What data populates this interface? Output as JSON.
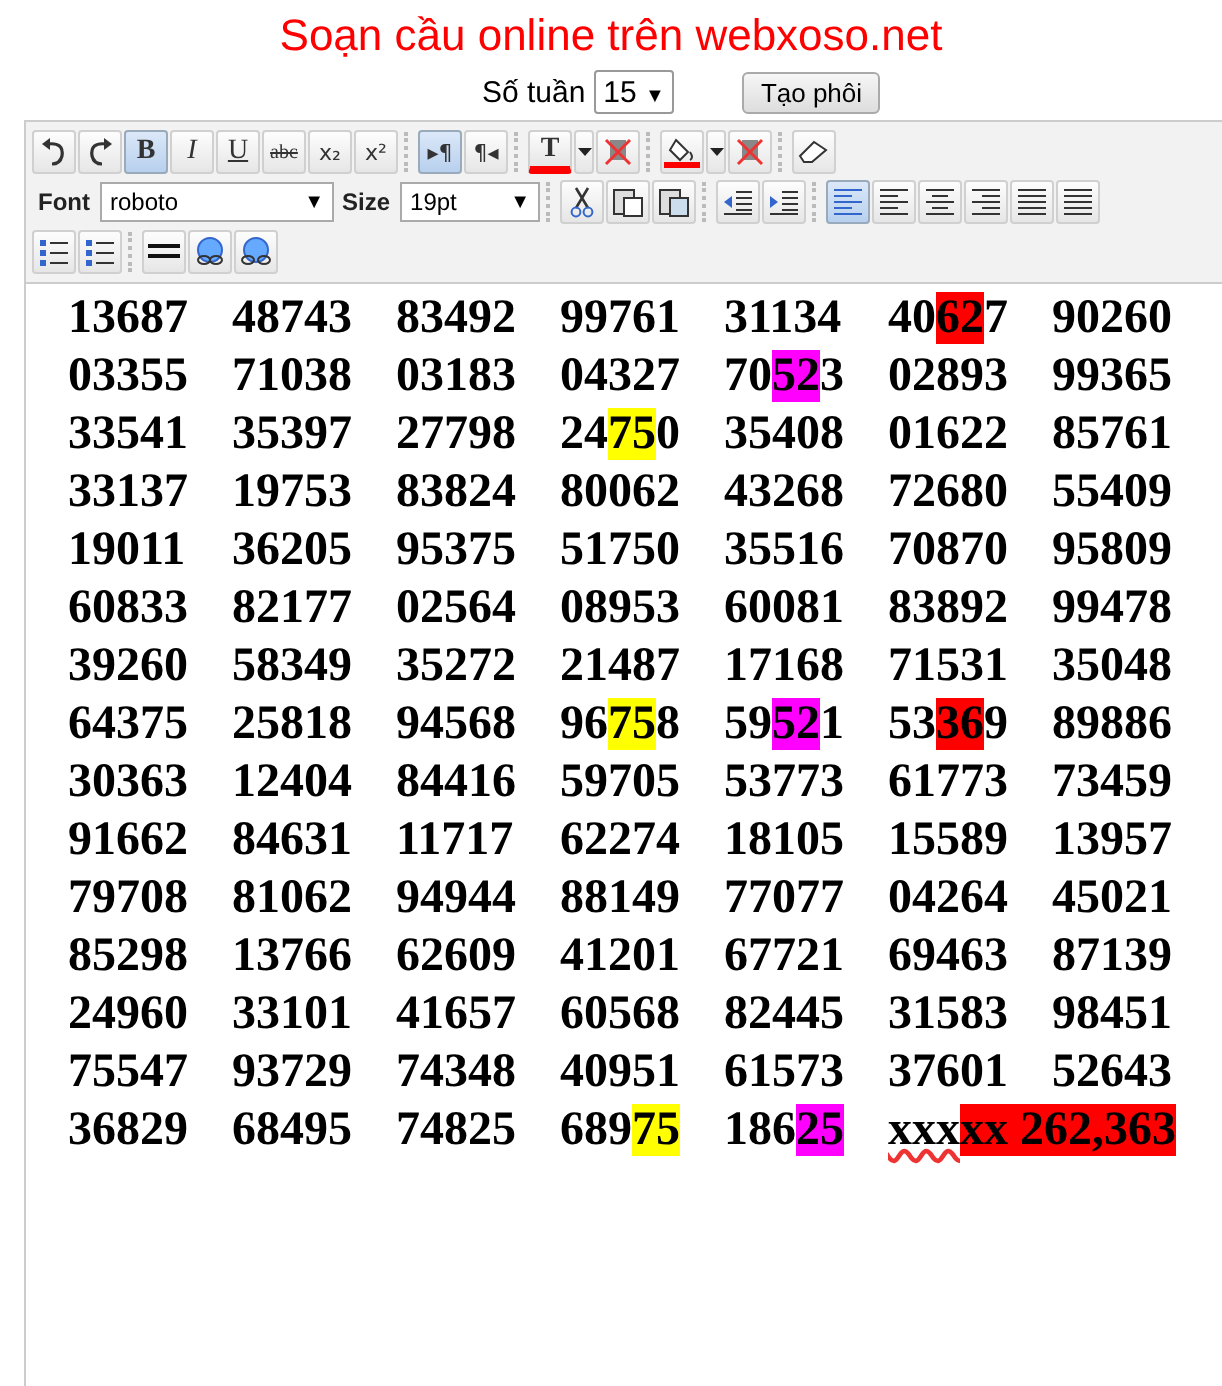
{
  "title": "Soạn cầu online trên webxoso.net",
  "week": {
    "label": "Số tuần",
    "value": "15",
    "arrow": "▼"
  },
  "create_button": "Tạo phôi",
  "toolbar_rows": [
    [
      [
        {
          "kind": "undo",
          "selected": false
        },
        {
          "kind": "redo",
          "selected": false
        },
        {
          "kind": "bold",
          "label": "B",
          "selected": true
        },
        {
          "kind": "italic",
          "label": "I",
          "selected": false
        },
        {
          "kind": "underline",
          "label": "U",
          "selected": false
        },
        {
          "kind": "strike",
          "label": "abc",
          "selected": false
        },
        {
          "kind": "subscript",
          "label": "x₂",
          "selected": false
        },
        {
          "kind": "superscript",
          "label": "x²",
          "selected": false
        }
      ],
      [
        {
          "kind": "ltr",
          "label": "▸¶",
          "selected": true
        },
        {
          "kind": "rtl",
          "label": "¶◂",
          "selected": false
        }
      ],
      [
        {
          "kind": "text-color",
          "label": "T",
          "selected": false
        },
        {
          "kind": "dropdown",
          "selected": false
        },
        {
          "kind": "remove-color",
          "selected": false
        }
      ],
      [
        {
          "kind": "bg-color",
          "selected": false
        },
        {
          "kind": "dropdown",
          "selected": false
        },
        {
          "kind": "remove-bg",
          "selected": false
        }
      ],
      [
        {
          "kind": "eraser",
          "selected": false
        }
      ]
    ],
    [
      [
        {
          "kind": "label",
          "label": "Font"
        },
        {
          "kind": "select",
          "label": "roboto",
          "arrow": "▼"
        },
        {
          "kind": "label",
          "label": "Size"
        },
        {
          "kind": "select-small",
          "label": "19pt",
          "arrow": "▼"
        }
      ],
      [
        {
          "kind": "cut",
          "selected": false
        },
        {
          "kind": "paste",
          "selected": false
        },
        {
          "kind": "paste-word",
          "selected": false
        }
      ],
      [
        {
          "kind": "outdent",
          "selected": false
        },
        {
          "kind": "indent",
          "selected": false
        }
      ],
      [
        {
          "kind": "align-para",
          "selected": true
        },
        {
          "kind": "align-left",
          "selected": false
        },
        {
          "kind": "align-center",
          "selected": false
        },
        {
          "kind": "align-right",
          "selected": false
        },
        {
          "kind": "align-justify",
          "selected": false
        },
        {
          "kind": "align-full",
          "selected": false
        }
      ]
    ],
    [
      [
        {
          "kind": "ordered-list",
          "selected": false
        },
        {
          "kind": "bullet-list",
          "selected": false
        }
      ],
      [
        {
          "kind": "hr",
          "selected": false
        },
        {
          "kind": "link",
          "selected": false
        },
        {
          "kind": "unlink",
          "selected": false
        }
      ]
    ]
  ],
  "rows": [
    [
      [
        {
          "text": "13687"
        }
      ],
      [
        {
          "text": "48743"
        }
      ],
      [
        {
          "text": "83492"
        }
      ],
      [
        {
          "text": "99761"
        }
      ],
      [
        {
          "text": "31134"
        }
      ],
      [
        {
          "text": "40"
        },
        {
          "text": "62",
          "color": "#ff0000"
        },
        {
          "text": "7"
        }
      ],
      [
        {
          "text": "90260"
        }
      ]
    ],
    [
      [
        {
          "text": "03355"
        }
      ],
      [
        {
          "text": "71038"
        }
      ],
      [
        {
          "text": "03183"
        }
      ],
      [
        {
          "text": "04327"
        }
      ],
      [
        {
          "text": "70"
        },
        {
          "text": "52",
          "color": "#ff00ff"
        },
        {
          "text": "3"
        }
      ],
      [
        {
          "text": "02893"
        }
      ],
      [
        {
          "text": "99365"
        }
      ]
    ],
    [
      [
        {
          "text": "33541"
        }
      ],
      [
        {
          "text": "35397"
        }
      ],
      [
        {
          "text": "27798"
        }
      ],
      [
        {
          "text": "24"
        },
        {
          "text": "75",
          "color": "#ffff00"
        },
        {
          "text": "0"
        }
      ],
      [
        {
          "text": "35408"
        }
      ],
      [
        {
          "text": "01622"
        }
      ],
      [
        {
          "text": "85761"
        }
      ]
    ],
    [
      [
        {
          "text": "33137"
        }
      ],
      [
        {
          "text": "19753"
        }
      ],
      [
        {
          "text": "83824"
        }
      ],
      [
        {
          "text": "80062"
        }
      ],
      [
        {
          "text": "43268"
        }
      ],
      [
        {
          "text": "72680"
        }
      ],
      [
        {
          "text": "55409"
        }
      ]
    ],
    [
      [
        {
          "text": "19011"
        }
      ],
      [
        {
          "text": "36205"
        }
      ],
      [
        {
          "text": "95375"
        }
      ],
      [
        {
          "text": "51750"
        }
      ],
      [
        {
          "text": "35516"
        }
      ],
      [
        {
          "text": "70870"
        }
      ],
      [
        {
          "text": "95809"
        }
      ]
    ],
    [
      [
        {
          "text": "60833"
        }
      ],
      [
        {
          "text": "82177"
        }
      ],
      [
        {
          "text": "02564"
        }
      ],
      [
        {
          "text": "08953"
        }
      ],
      [
        {
          "text": "60081"
        }
      ],
      [
        {
          "text": "83892"
        }
      ],
      [
        {
          "text": "99478"
        }
      ]
    ],
    [
      [
        {
          "text": "39260"
        }
      ],
      [
        {
          "text": "58349"
        }
      ],
      [
        {
          "text": "35272"
        }
      ],
      [
        {
          "text": "21487"
        }
      ],
      [
        {
          "text": "17168"
        }
      ],
      [
        {
          "text": "71531"
        }
      ],
      [
        {
          "text": "35048"
        }
      ]
    ],
    [
      [
        {
          "text": "64375"
        }
      ],
      [
        {
          "text": "25818"
        }
      ],
      [
        {
          "text": "94568"
        }
      ],
      [
        {
          "text": "96"
        },
        {
          "text": "75",
          "color": "#ffff00"
        },
        {
          "text": "8"
        }
      ],
      [
        {
          "text": "59"
        },
        {
          "text": "52",
          "color": "#ff00ff"
        },
        {
          "text": "1"
        }
      ],
      [
        {
          "text": "53"
        },
        {
          "text": "36",
          "color": "#ff0000"
        },
        {
          "text": "9"
        }
      ],
      [
        {
          "text": "89886"
        }
      ]
    ],
    [
      [
        {
          "text": "30363"
        }
      ],
      [
        {
          "text": "12404"
        }
      ],
      [
        {
          "text": "84416"
        }
      ],
      [
        {
          "text": "59705"
        }
      ],
      [
        {
          "text": "53773"
        }
      ],
      [
        {
          "text": "61773"
        }
      ],
      [
        {
          "text": "73459"
        }
      ]
    ],
    [
      [
        {
          "text": "91662"
        }
      ],
      [
        {
          "text": "84631"
        }
      ],
      [
        {
          "text": "11717"
        }
      ],
      [
        {
          "text": "62274"
        }
      ],
      [
        {
          "text": "18105"
        }
      ],
      [
        {
          "text": "15589"
        }
      ],
      [
        {
          "text": "13957"
        }
      ]
    ],
    [
      [
        {
          "text": "79708"
        }
      ],
      [
        {
          "text": "81062"
        }
      ],
      [
        {
          "text": "94944"
        }
      ],
      [
        {
          "text": "88149"
        }
      ],
      [
        {
          "text": "77077"
        }
      ],
      [
        {
          "text": "04264"
        }
      ],
      [
        {
          "text": "45021"
        }
      ]
    ],
    [
      [
        {
          "text": "85298"
        }
      ],
      [
        {
          "text": "13766"
        }
      ],
      [
        {
          "text": "62609"
        }
      ],
      [
        {
          "text": "41201"
        }
      ],
      [
        {
          "text": "67721"
        }
      ],
      [
        {
          "text": "69463"
        }
      ],
      [
        {
          "text": "87139"
        }
      ]
    ],
    [
      [
        {
          "text": "24960"
        }
      ],
      [
        {
          "text": "33101"
        }
      ],
      [
        {
          "text": "41657"
        }
      ],
      [
        {
          "text": "60568"
        }
      ],
      [
        {
          "text": "82445"
        }
      ],
      [
        {
          "text": "31583"
        }
      ],
      [
        {
          "text": "98451"
        }
      ]
    ],
    [
      [
        {
          "text": "75547"
        }
      ],
      [
        {
          "text": "93729"
        }
      ],
      [
        {
          "text": "74348"
        }
      ],
      [
        {
          "text": "40951"
        }
      ],
      [
        {
          "text": "61573"
        }
      ],
      [
        {
          "text": "37601"
        }
      ],
      [
        {
          "text": "52643"
        }
      ]
    ],
    [
      [
        {
          "text": "36829"
        }
      ],
      [
        {
          "text": "68495"
        }
      ],
      [
        {
          "text": "74825"
        }
      ],
      [
        {
          "text": "689"
        },
        {
          "text": "75",
          "color": "#ffff00"
        }
      ],
      [
        {
          "text": "186"
        },
        {
          "text": "25",
          "color": "#ff00ff"
        }
      ],
      [
        {
          "text": "xxx",
          "misspelled": true
        },
        {
          "text": "xx 262,363",
          "color": "#ff0000"
        }
      ]
    ]
  ]
}
